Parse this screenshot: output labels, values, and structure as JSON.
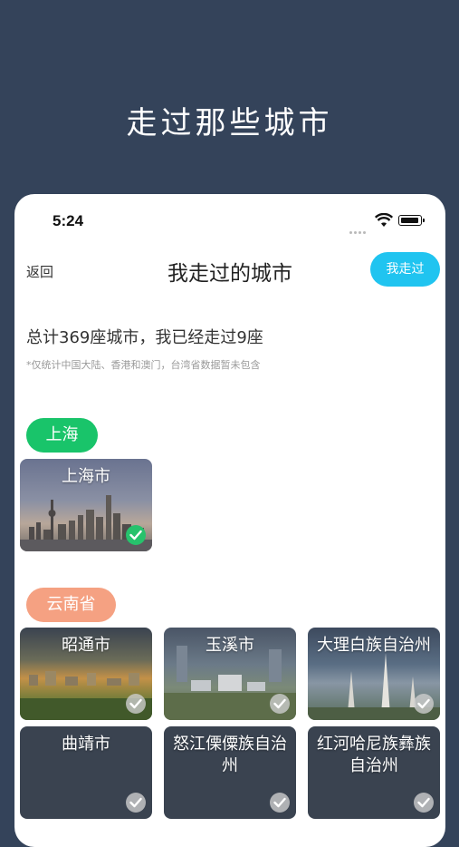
{
  "banner": {
    "title": "走过那些城市"
  },
  "status_bar": {
    "time": "5:24"
  },
  "nav": {
    "back_label": "返回",
    "title": "我走过的城市",
    "walked_button": "我走过"
  },
  "summary": {
    "text": "总计369座城市，我已经走过9座",
    "note": "*仅统计中国大陆、香港和澳门，台湾省数据暂未包含"
  },
  "provinces": [
    {
      "name": "上海",
      "color": "#19c46a",
      "cities": [
        {
          "name": "上海市",
          "checked": true
        }
      ]
    },
    {
      "name": "云南省",
      "color": "#f5a182",
      "cities": [
        {
          "name": "昭通市",
          "checked": false
        },
        {
          "name": "玉溪市",
          "checked": false
        },
        {
          "name": "大理白族自治州",
          "checked": false
        },
        {
          "name": "曲靖市",
          "checked": false
        },
        {
          "name": "怒江傈僳族自治州",
          "checked": false
        },
        {
          "name": "红河哈尼族彝族自治州",
          "checked": false
        }
      ]
    }
  ],
  "colors": {
    "background": "#34435a",
    "accent": "#20c4f0",
    "checked": "#27c26c"
  }
}
